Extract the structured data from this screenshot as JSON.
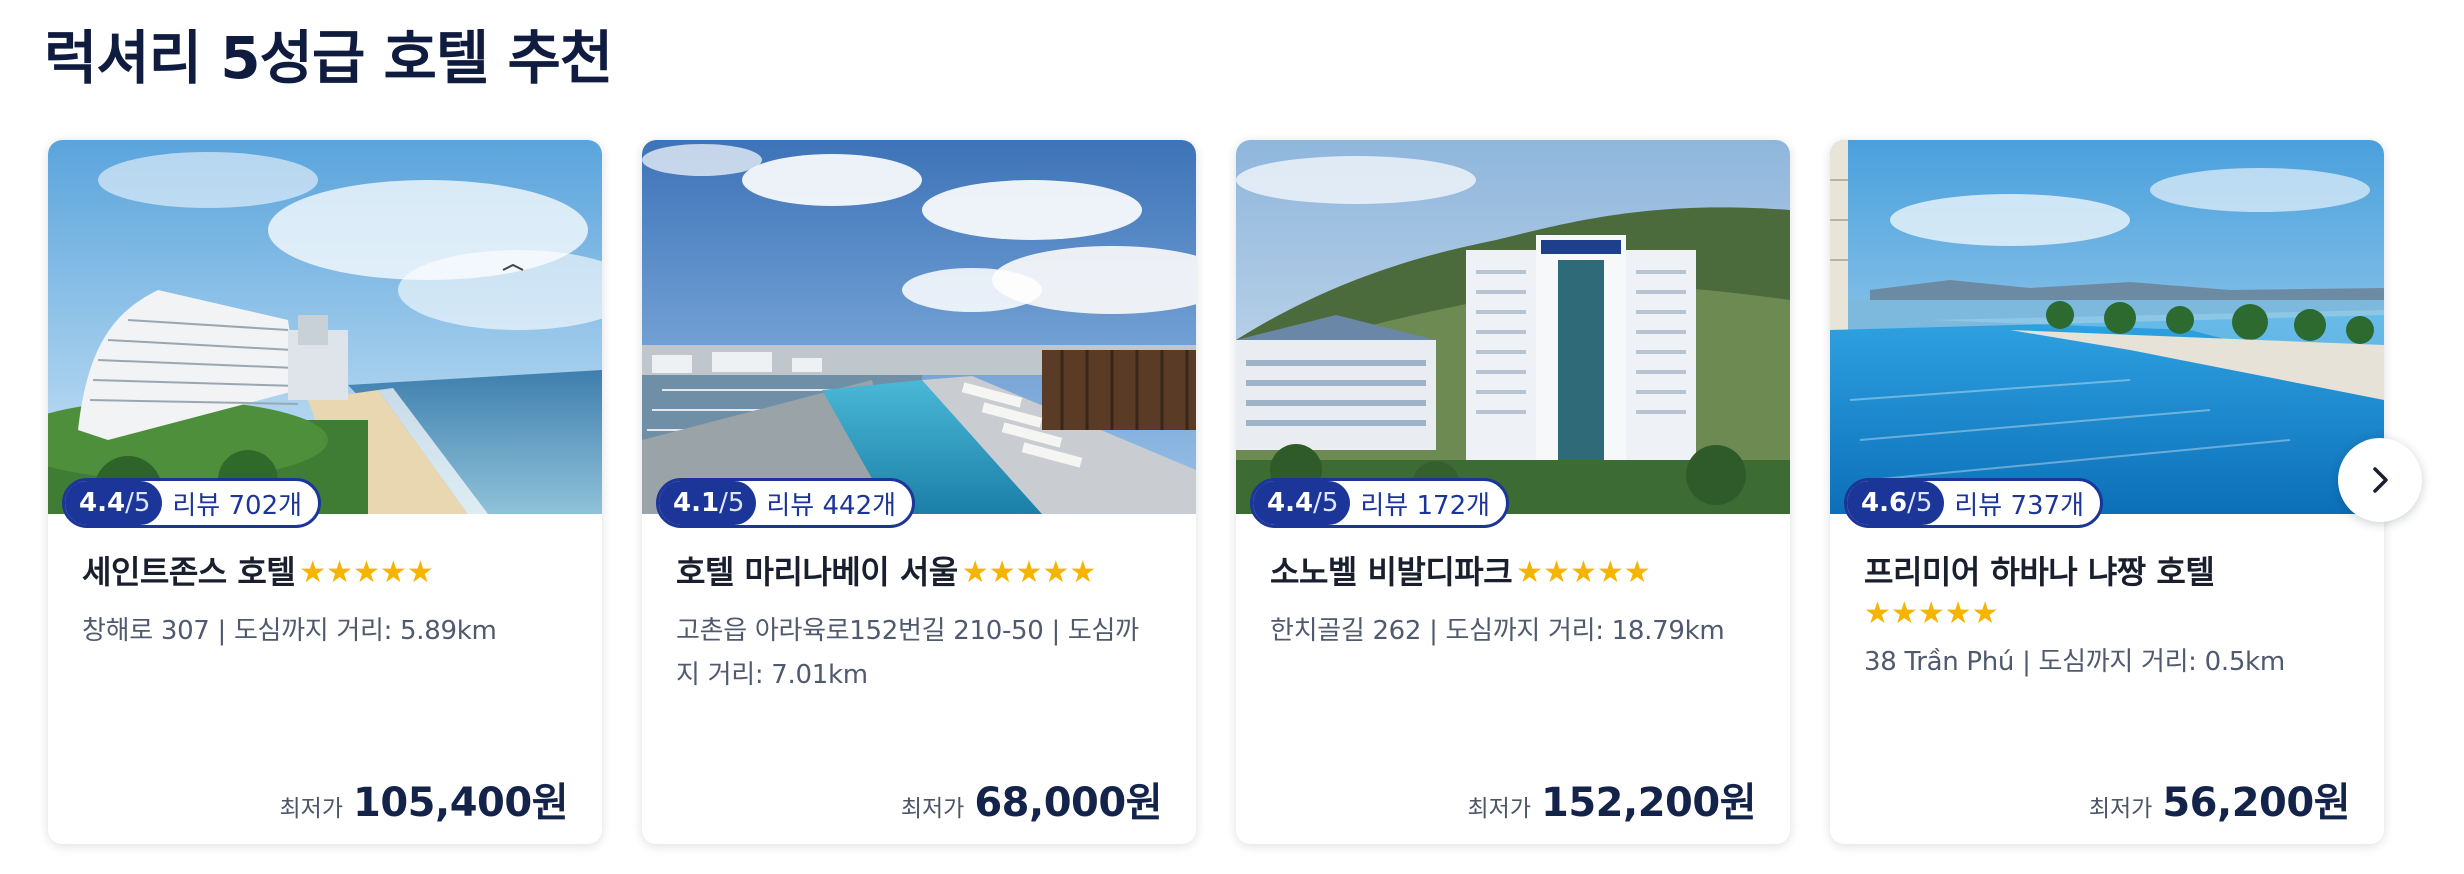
{
  "section": {
    "title": "럭셔리 5성급 호텔 추천"
  },
  "hotels": [
    {
      "rating": "4.4",
      "rating_max": "/5",
      "reviews": "리뷰 702개",
      "name": "세인트존스 호텔",
      "stars": "★★★★★",
      "address": "창해로 307 | 도심까지 거리: 5.89km",
      "price_prefix": "최저가",
      "price": "105,400원"
    },
    {
      "rating": "4.1",
      "rating_max": "/5",
      "reviews": "리뷰 442개",
      "name": "호텔 마리나베이 서울",
      "stars": "★★★★★",
      "address": "고촌읍 아라육로152번길 210-50 | 도심까지 거리: 7.01km",
      "price_prefix": "최저가",
      "price": "68,000원"
    },
    {
      "rating": "4.4",
      "rating_max": "/5",
      "reviews": "리뷰 172개",
      "name": "소노벨 비발디파크",
      "stars": "★★★★★",
      "address": "한치골길 262 | 도심까지 거리: 18.79km",
      "price_prefix": "최저가",
      "price": "152,200원"
    },
    {
      "rating": "4.6",
      "rating_max": "/5",
      "reviews": "리뷰 737개",
      "name": "프리미어 하바나 냐짱 호텔",
      "stars": "★★★★★",
      "address": "38 Trần Phú | 도심까지 거리: 0.5km",
      "price_prefix": "최저가",
      "price": "56,200원"
    }
  ],
  "carousel": {
    "next_icon": "chevron-right-icon"
  },
  "colors": {
    "accent": "#1b3599",
    "star": "#f5b400",
    "title": "#0f1c3f"
  }
}
